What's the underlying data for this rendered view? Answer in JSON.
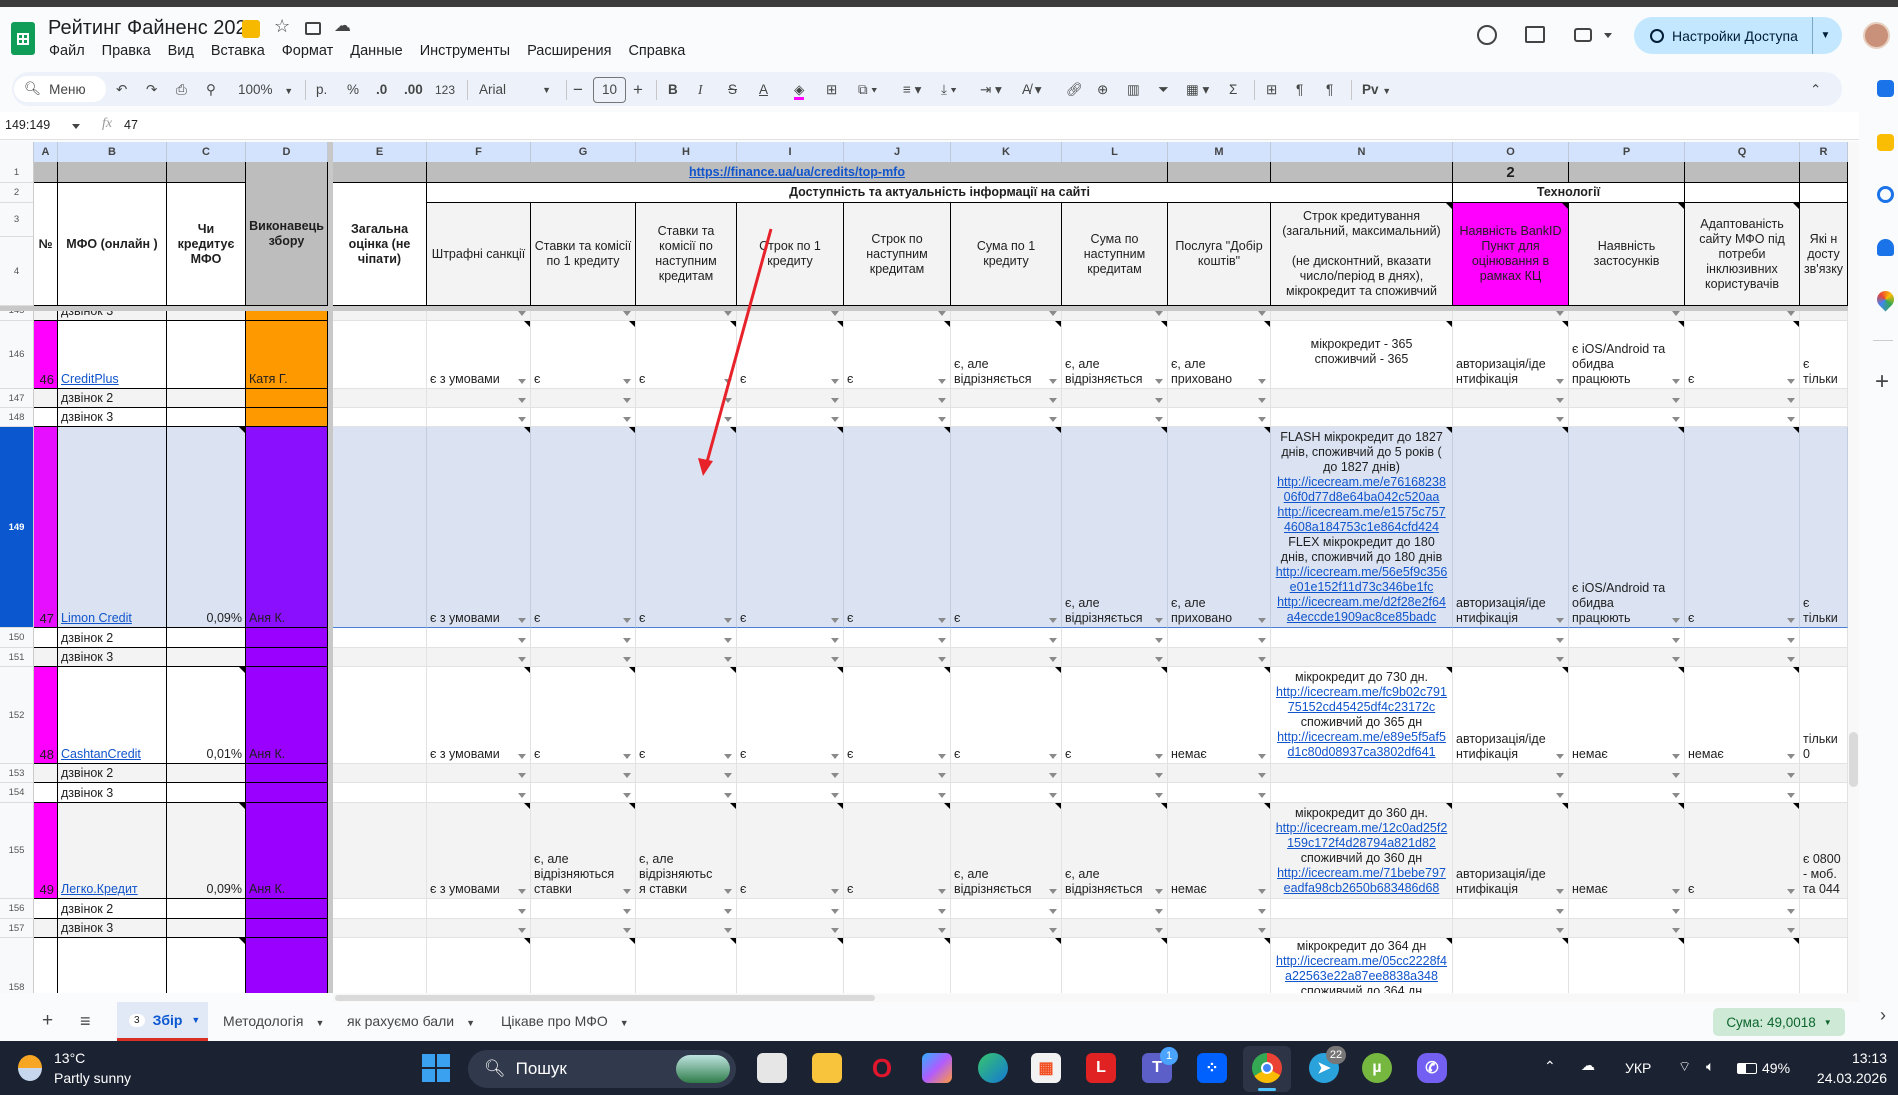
{
  "app": {
    "title": "Рейтинг Файненс 2026",
    "menu": [
      "Файл",
      "Правка",
      "Вид",
      "Вставка",
      "Формат",
      "Данные",
      "Инструменты",
      "Расширения",
      "Справка"
    ],
    "share_button": "Настройки Доступа",
    "icons": [
      "sheets-logo-icon",
      "star-icon",
      "move-to-folder-icon",
      "cloud-saved-icon",
      "history-icon",
      "comments-icon",
      "meet-icon",
      "avatar"
    ]
  },
  "toolbar": {
    "search": "Меню",
    "zoom": "100%",
    "currency": "р.",
    "percent": "%",
    "dec_decrease": ".0",
    "dec_increase": ".00",
    "number_format": "123",
    "font": "Arial",
    "font_size": "10",
    "minus": "−",
    "plus": "+",
    "bold": "B",
    "italic": "I",
    "strike": "S",
    "text_color": "A",
    "sum": "Σ",
    "input_tools": "Pv"
  },
  "formula_bar": {
    "name_box": "149:149",
    "fx": "fx",
    "value": "47"
  },
  "sheet": {
    "columns": [
      "A",
      "B",
      "C",
      "D",
      "E",
      "F",
      "G",
      "H",
      "I",
      "J",
      "K",
      "L",
      "M",
      "N",
      "O",
      "P",
      "Q",
      "R"
    ],
    "header": {
      "link": "https://finance.ua/ua/credits/top-mfo",
      "o1": "2",
      "group_access": "Доступність та актуальність інформації на сайті",
      "group_tech": "Технології",
      "A": "№",
      "B": "МФО (онлайн )",
      "C": "Чи кредитує МФО",
      "D": "Виконавець збору",
      "E": "Загальна оцінка (не чіпати)",
      "F": "Штрафні санкції",
      "G": "Ставки та комісії по 1 кредиту",
      "H": "Ставки та комісії по наступним кредитам",
      "I": "Строк по 1 кредиту",
      "J": "Строк по наступним кредитам",
      "K": "Сума по 1 кредиту",
      "L": "Сума по наступним кредитам",
      "M": "Послуга \"Добір коштів\"",
      "N": "Строк кредитування (загальний, максимальний)\n\n(не дисконтний, вказати число/період в днях), мікрокредит та споживчий",
      "O": "Наявність BankID Пункт для оцінювання в рамках КЦ",
      "P": "Наявність застосунків",
      "Q": "Адаптованість сайту МФО під потреби інклюзивних користувачів",
      "R": "Які н\nдосту\nзв'язку"
    },
    "header_rows": [
      "1",
      "2",
      "3",
      "4"
    ],
    "colors": {
      "magenta": "#ff00ff",
      "orange": "#ff9900",
      "purple": "#9900ff",
      "header_gray": "#bdbdbd",
      "selected_row": "#dbe3f3",
      "selected_header": "#0b57d0",
      "annotation_arrow": "#e8222a"
    },
    "rows": [
      {
        "num": "145",
        "cells": {
          "B": "дзвінок 3"
        }
      },
      {
        "num": "146",
        "cells": {
          "A": "46",
          "B": {
            "text": "CreditPlus",
            "link": true
          },
          "D": "Катя Г.",
          "F": "є з умовами",
          "G": "є",
          "H": "є",
          "I": "є",
          "J": "є",
          "K": "є, але відрізняється",
          "L": "є, але відрізняється",
          "M": "є, але приховано",
          "N": [
            {
              "t": "мікрокредит - 365"
            },
            {
              "t": "споживчий - 365"
            }
          ],
          "O": "авторизація/ідентифікація",
          "P": "є iOS/Android та обидва працюють",
          "Q": "є",
          "R": "є тільки"
        }
      },
      {
        "num": "147",
        "cells": {
          "B": "дзвінок 2"
        }
      },
      {
        "num": "148",
        "cells": {
          "B": "дзвінок 3"
        }
      },
      {
        "num": "149",
        "cells": {
          "A": "47",
          "B": {
            "text": "Limon Credit",
            "link": true
          },
          "C": "0,09%",
          "D": "Аня К.",
          "F": "є з умовами",
          "G": "є",
          "H": "є",
          "I": "є",
          "J": "є",
          "K": "є",
          "L": "є, але відрізняється",
          "M": "є, але приховано",
          "N": [
            {
              "t": "FLASH  мікрокредит до 1827 днів, споживчий до  5 років  ( до 1827 днів)"
            },
            {
              "t": "http://icecream.me/e7616823806f0d77d8e64ba042c520aa",
              "link": true
            },
            {
              "t": "http://icecream.me/e1575c7574608a184753c1e864cfd424",
              "link": true
            },
            {
              "t": "FLEX  мікрокредит до 180 днів, споживчий до 180 днів"
            },
            {
              "t": "http://icecream.me/56e5f9c356e01e152f11d73c346be1fc",
              "link": true
            },
            {
              "t": "http://icecream.me/d2f28e2f64a4eccde1909ac8ce85badc",
              "link": true
            }
          ],
          "O": "авторизація/ідентифікація",
          "P": "є iOS/Android та обидва працюють",
          "Q": "є",
          "R": "є тільки"
        }
      },
      {
        "num": "150",
        "cells": {
          "B": "дзвінок 2"
        }
      },
      {
        "num": "151",
        "cells": {
          "B": "дзвінок 3"
        }
      },
      {
        "num": "152",
        "cells": {
          "A": "48",
          "B": {
            "text": "CashtanCredit",
            "link": true
          },
          "C": "0,01%",
          "D": "Аня К.",
          "F": "є з умовами",
          "G": "є",
          "H": "є",
          "I": "є",
          "J": "є",
          "K": "є",
          "L": "є",
          "M": "немає",
          "N": [
            {
              "t": "мікрокредит до 730 дн."
            },
            {
              "t": "http://icecream.me/fc9b02c79175152cd45425df4c23172c",
              "link": true
            },
            {
              "t": "споживчий  до 365 дн"
            },
            {
              "t": "http://icecream.me/e89e5f5af5d1c80d08937ca3802df641",
              "link": true
            }
          ],
          "O": "авторизація/ідентифікація",
          "P": "немає",
          "Q": "немає",
          "R": "тільки 0"
        }
      },
      {
        "num": "153",
        "cells": {
          "B": "дзвінок 2"
        }
      },
      {
        "num": "154",
        "cells": {
          "B": "дзвінок 3"
        }
      },
      {
        "num": "155",
        "cells": {
          "A": "49",
          "B": {
            "text": "Легко.Кредит",
            "link": true
          },
          "C": "0,09%",
          "D": "Аня К.",
          "F": "є з умовами",
          "G": "є, але відрізняються ставки",
          "H": "є, але відрізняються ставки",
          "I": "є",
          "J": "є",
          "K": "є, але відрізняється",
          "L": "є, але відрізняється",
          "M": "немає",
          "N": [
            {
              "t": "мікрокредит до 360 дн."
            },
            {
              "t": "http://icecream.me/12c0ad25f2159c172f4d28794a821d82",
              "link": true
            },
            {
              "t": "споживчий  до 360 дн"
            },
            {
              "t": "http://icecream.me/71bebe797eadfa98cb2650b683486d68",
              "link": true
            }
          ],
          "O": "авторизація/ідентифікація",
          "P": "немає",
          "Q": "є",
          "R": "є 0800 - моб. та 044"
        }
      },
      {
        "num": "156",
        "cells": {
          "B": "дзвінок 2"
        }
      },
      {
        "num": "157",
        "cells": {
          "B": "дзвінок 3"
        }
      },
      {
        "num": "158",
        "cells": {
          "N": [
            {
              "t": "мікрокредит до 364 дн"
            },
            {
              "t": "http://icecream.me/05cc2228f4a22563e22a87ee8838a348",
              "link": true
            },
            {
              "t": "споживчий до 364 дн"
            }
          ]
        }
      }
    ]
  },
  "tabs": {
    "add": "+",
    "all_sheets": "≡",
    "items": [
      {
        "label": "Збір",
        "badge": "3",
        "active": true
      },
      {
        "label": "Методологія"
      },
      {
        "label": "як рахуємо бали"
      },
      {
        "label": "Цікаве про МФО"
      }
    ],
    "sum": "Сума: 49,0018"
  },
  "side_panel": {
    "icons": [
      "calendar-icon",
      "keep-icon",
      "tasks-icon",
      "contacts-icon",
      "maps-icon",
      "add-icon"
    ]
  },
  "taskbar": {
    "temperature": "13°C",
    "weather": "Partly sunny",
    "search": "Пошук",
    "apps": [
      "task-view",
      "file-explorer",
      "opera",
      "copilot",
      "edge",
      "store",
      "l-app",
      "teams",
      "dropbox",
      "chrome",
      "telegram",
      "utorrent",
      "viber"
    ],
    "teams_badge": "1",
    "telegram_badge": "22",
    "language": "УКР",
    "battery": "49%",
    "time": "13:13",
    "date": "24.03.2026"
  }
}
